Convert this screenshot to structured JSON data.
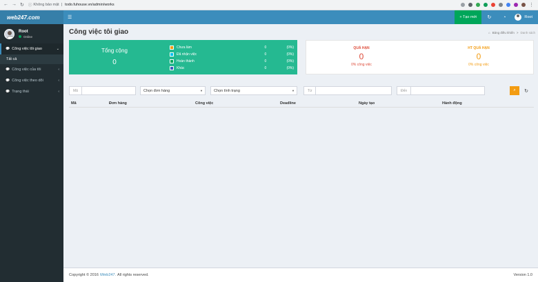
{
  "browser": {
    "security": "Không bảo mật",
    "url": "todo.fuhouse.vn/admin/works"
  },
  "sidebar": {
    "logo": "web247.com",
    "user_name": "Root",
    "user_status": "Online",
    "items": [
      {
        "label": "Công việc tôi giao"
      },
      {
        "label": "Tất cả"
      },
      {
        "label": "Công việc của tôi"
      },
      {
        "label": "Công việc theo dõi"
      },
      {
        "label": "Trạng thái"
      }
    ]
  },
  "navbar": {
    "new_button": "+ Tạo mới",
    "user_name": "Root"
  },
  "header": {
    "title": "Công việc tôi giao",
    "breadcrumb_home": "Bảng điều khiển",
    "breadcrumb_sep": ">",
    "breadcrumb_current": "Danh sách"
  },
  "summary": {
    "total_label": "Tổng cộng",
    "total_value": "0",
    "statuses": [
      {
        "label": "Chưa làm",
        "count": "0",
        "percent": "(0%)",
        "color": "#f39c12"
      },
      {
        "label": "Đã nhận việc",
        "count": "0",
        "percent": "(0%)",
        "color": "#00c0ef"
      },
      {
        "label": "Hoàn thành",
        "count": "0",
        "percent": "(0%)",
        "color": "#00a65a"
      },
      {
        "label": "Khác",
        "count": "0",
        "percent": "(0%)",
        "color": "#3c5abc"
      }
    ],
    "overdue_label": "QUÁ HẠN",
    "overdue_value": "0",
    "overdue_sub": "0% công việc",
    "done_overdue_label": "HT QUÁ HẠN",
    "done_overdue_value": "0",
    "done_overdue_sub": "0% công việc"
  },
  "filters": {
    "code_label": "Mã",
    "order_select": "Chọn đơn hàng",
    "status_select": "Chọn tình trạng",
    "from_label": "Từ",
    "to_label": "Đến"
  },
  "table": {
    "columns": [
      "Mã",
      "Đơn hàng",
      "Công việc",
      "Deadline",
      "Ngày tạo",
      "Hành động"
    ]
  },
  "footer": {
    "copyright_pre": "Copyright © 2016",
    "brand": "iWeb247.",
    "copyright_post": "All rights reserved.",
    "version": "Version 1.0"
  },
  "colors": {
    "primary": "#3c8dbc",
    "sidebar": "#222d32",
    "summary_green": "#25b991",
    "danger": "#dd4b39",
    "warning": "#f39c12",
    "success": "#00a65a"
  }
}
